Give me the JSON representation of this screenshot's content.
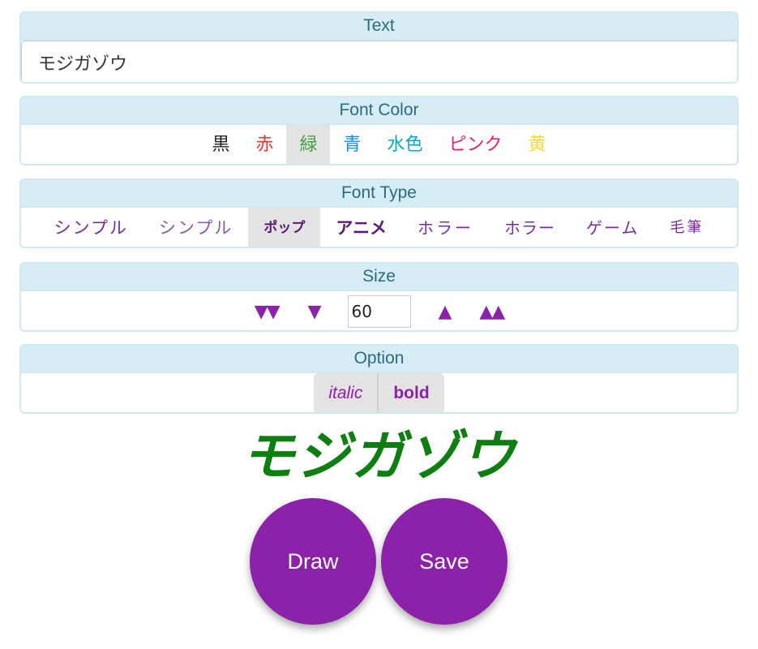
{
  "text_panel": {
    "header": "Text",
    "value": "モジガゾウ"
  },
  "color_panel": {
    "header": "Font Color",
    "items": [
      {
        "label": "黒",
        "color": "#222222"
      },
      {
        "label": "赤",
        "color": "#e53935"
      },
      {
        "label": "緑",
        "color": "#43a047"
      },
      {
        "label": "青",
        "color": "#1e88e5"
      },
      {
        "label": "水色",
        "color": "#00acc1"
      },
      {
        "label": "ピンク",
        "color": "#e91e63"
      },
      {
        "label": "黄",
        "color": "#fdd835"
      }
    ],
    "selected": "緑"
  },
  "type_panel": {
    "header": "Font Type",
    "items": [
      "シンプル",
      "シンプル",
      "ポップ",
      "アニメ",
      "ホラー",
      "ホラー",
      "ゲーム",
      "毛筆"
    ],
    "selected_index": 2
  },
  "size_panel": {
    "header": "Size",
    "dec_big": "▼▼",
    "dec": "▼",
    "value": "60",
    "inc": "▲",
    "inc_big": "▲▲"
  },
  "option_panel": {
    "header": "Option",
    "italic_label": "italic",
    "bold_label": "bold"
  },
  "preview": {
    "text": "モジガゾウ",
    "color": "#0c7f10"
  },
  "actions": {
    "draw_label": "Draw",
    "save_label": "Save",
    "color": "#8b22a9"
  }
}
